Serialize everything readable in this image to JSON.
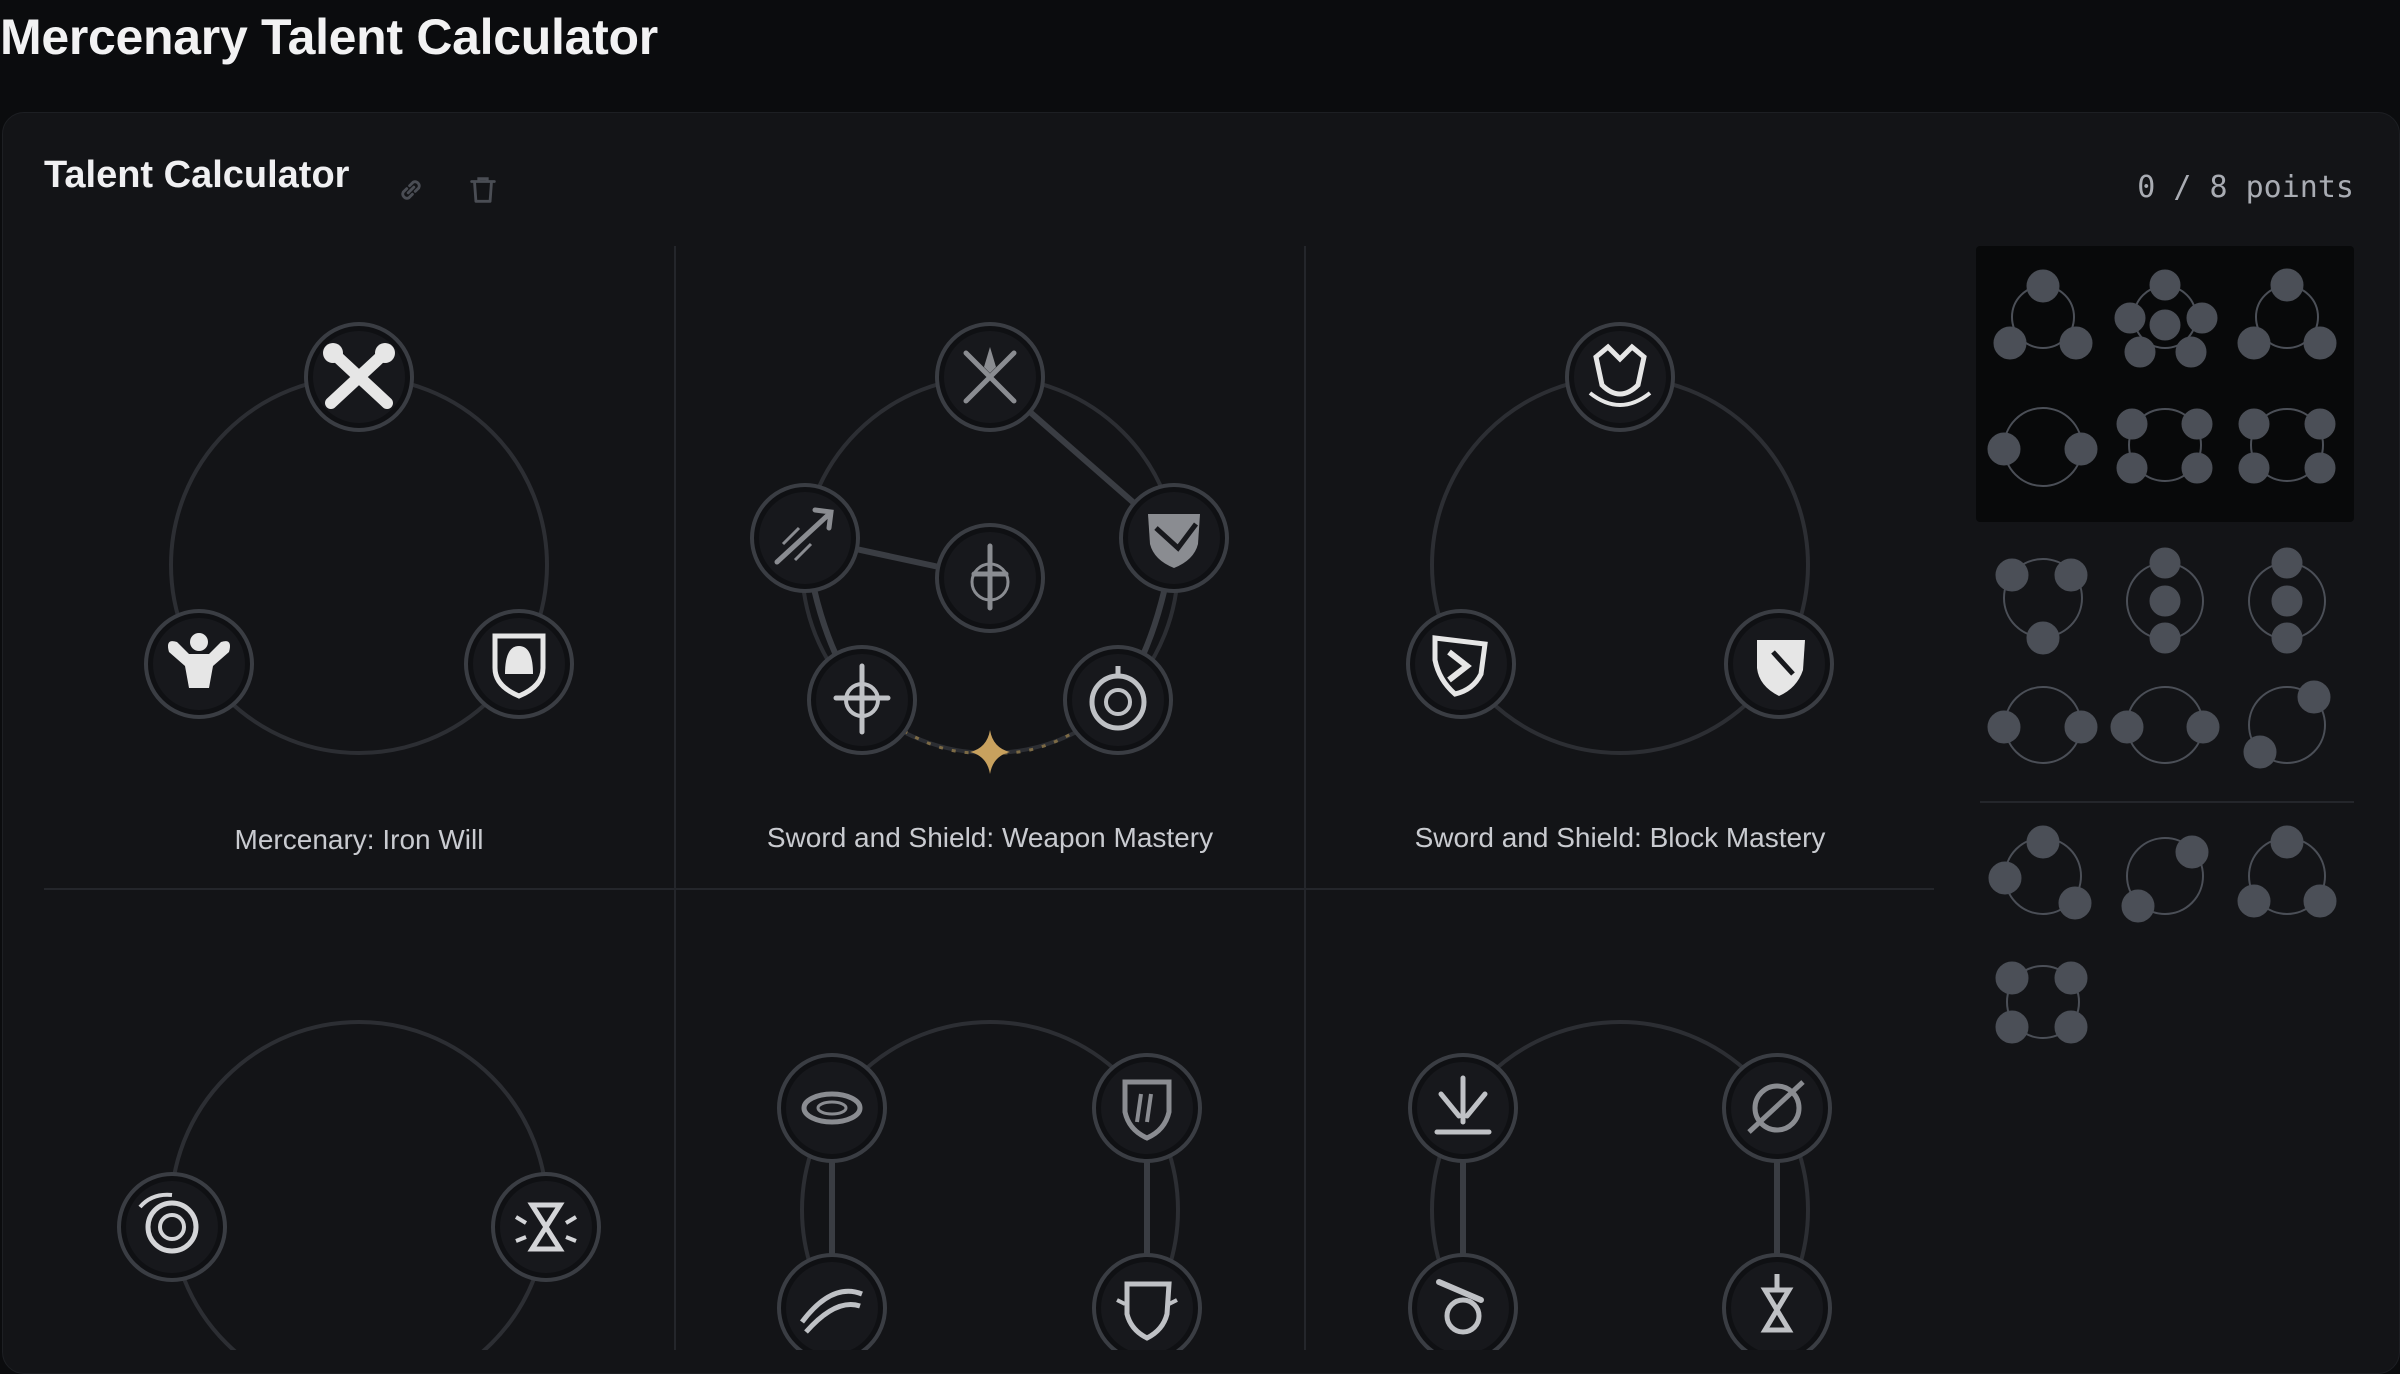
{
  "page": {
    "title": "Mercenary Talent Calculator"
  },
  "calculator": {
    "title": "Talent Calculator",
    "points_spent": 0,
    "points_total": 8,
    "points_label": "0 / 8 points",
    "share_icon": "link-icon",
    "clear_icon": "trash-icon"
  },
  "colors": {
    "background": "#0b0c0e",
    "panel": "#131417",
    "node_fill": "#101114",
    "ring": "#2f3136",
    "accent_star": "#c8a15e",
    "preset_dot": "#4b4f57"
  },
  "trees": [
    {
      "label": "Mercenary: Iron Will",
      "nodes": [
        "crossed-fists-icon",
        "muscle-body-icon",
        "helmet-shield-icon"
      ]
    },
    {
      "label": "Sword and Shield: Weapon Mastery",
      "nodes": [
        "crossed-swords-icon",
        "thrust-icon",
        "shield-slash-icon",
        "sword-core-icon",
        "sword-emblem-icon",
        "round-shield-icon"
      ],
      "has_keystone": true
    },
    {
      "label": "Sword and Shield: Block Mastery",
      "nodes": [
        "wolf-howl-icon",
        "shield-chevron-icon",
        "shield-strike-icon"
      ]
    },
    {
      "label": "",
      "nodes": [
        "spiral-shield-icon",
        "hourglass-burst-icon"
      ]
    },
    {
      "label": "",
      "nodes": [
        "whirlwind-icon",
        "shield-scratch-icon",
        "slash-wave-icon",
        "shield-clash-icon"
      ]
    },
    {
      "label": "",
      "nodes": [
        "ground-slam-icon",
        "lance-shield-icon",
        "spin-slash-icon",
        "hourglass-sword-icon"
      ]
    }
  ]
}
